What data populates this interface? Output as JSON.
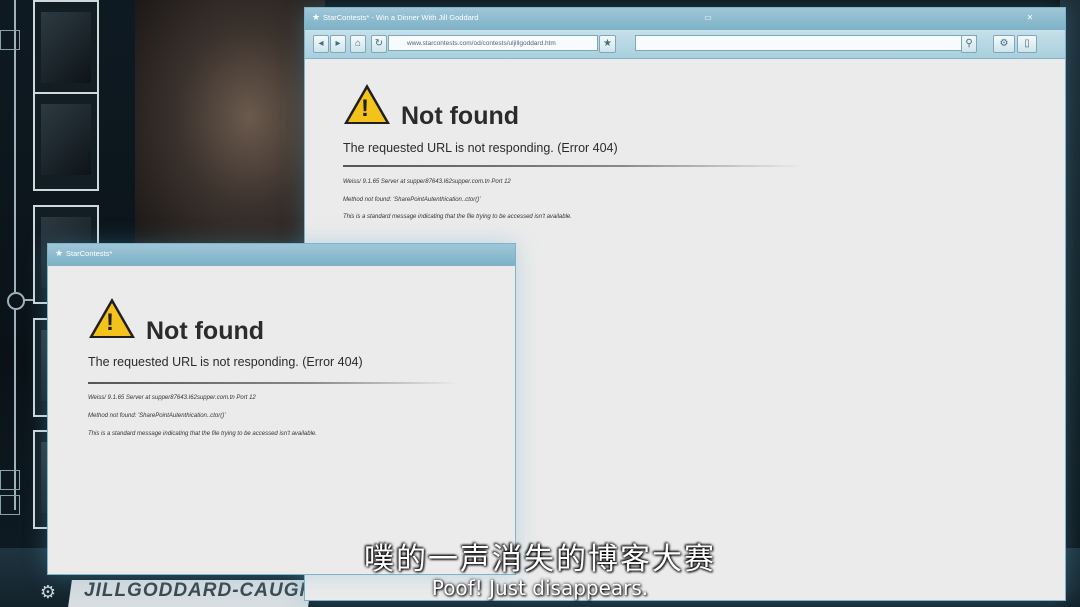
{
  "main_window": {
    "title": "StarContests* - Win a Dinner With Jill Goddard",
    "url": "www.starcontests.com/od/contests/uljillgoddard.htm",
    "error": {
      "heading": "Not found",
      "message": "The requested URL is not responding. (Error 404)",
      "server_line": "Weiss/ 9.1.65 Server at supper87643.I62supper.com.tn Port 12",
      "method_line": "Method not found: 'SharePointAutenthication..ctor()'",
      "info_line": "This is a standard message indicating that the file trying to be accessed isn't available."
    }
  },
  "popup_window": {
    "title": "StarContests*",
    "error": {
      "heading": "Not found",
      "message": "The requested URL is not responding. (Error 404)",
      "server_line": "Weiss/ 9.1.65 Server at supper87643.I62supper.com.tn Port 12",
      "method_line": "Method not found: 'SharePointAutenthication..ctor()'",
      "info_line": "This is a standard message indicating that the file trying to be accessed isn't available."
    }
  },
  "background": {
    "domain_banner": "JILLGODDARD-CAUGHT.CO"
  },
  "subtitles": {
    "chinese": "噗的一声消失的博客大赛",
    "english": "Poof! Just disappears."
  },
  "icons": {
    "warning": "warning-triangle-icon",
    "settings": "gear-icon"
  },
  "colors": {
    "titlebar": "#7db0c6",
    "warning_fill": "#f3c21b",
    "page_bg": "#ebebeb"
  }
}
